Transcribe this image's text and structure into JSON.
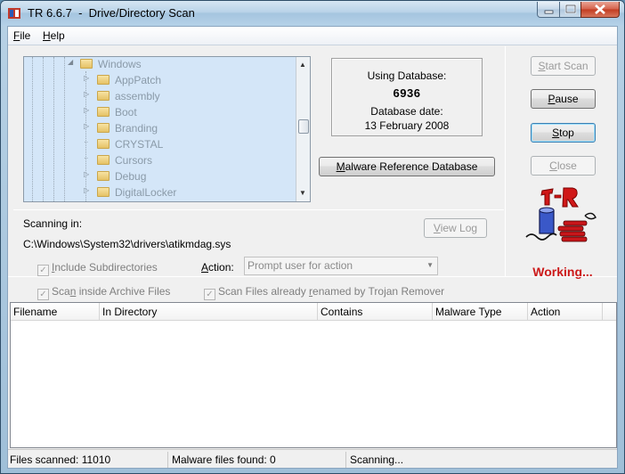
{
  "window": {
    "title": "TR 6.6.7  -  Drive/Directory Scan"
  },
  "menu": {
    "file_prefix": "",
    "file_hotkey": "F",
    "file_rest": "ile",
    "help_hotkey": "H",
    "help_rest": "elp"
  },
  "tree": {
    "root": "Windows",
    "items": [
      {
        "label": "AppPatch",
        "expandable": true
      },
      {
        "label": "assembly",
        "expandable": true
      },
      {
        "label": "Boot",
        "expandable": true
      },
      {
        "label": "Branding",
        "expandable": true
      },
      {
        "label": "CRYSTAL",
        "expandable": false
      },
      {
        "label": "Cursors",
        "expandable": false
      },
      {
        "label": "Debug",
        "expandable": true
      },
      {
        "label": "DigitalLocker",
        "expandable": true
      }
    ]
  },
  "database": {
    "using_label": "Using Database:",
    "number": "6936",
    "date_label": "Database date:",
    "date": "13 February 2008"
  },
  "buttons": {
    "malware_ref_hotkey": "M",
    "malware_ref_rest": "alware Reference Database",
    "start_scan_hotkey": "S",
    "start_scan_rest": "tart Scan",
    "pause_hotkey": "P",
    "pause_rest": "ause",
    "stop_hotkey": "S",
    "stop_rest": "top",
    "close_hotkey": "C",
    "close_rest": "lose",
    "view_log_hotkey": "V",
    "view_log_rest": "iew Log"
  },
  "scan": {
    "scanning_label": "Scanning in:",
    "path": "C:\\Windows\\System32\\drivers\\atikmdag.sys",
    "status_text": "Working..."
  },
  "options": {
    "subdirs_hotkey": "I",
    "subdirs_rest": "nclude Subdirectories",
    "subdirs_checked": true,
    "archive_pre": "Sca",
    "archive_hotkey": "n",
    "archive_rest": " inside Archive Files",
    "archive_checked": true,
    "renamed_pre": "Scan Files already ",
    "renamed_hotkey": "r",
    "renamed_rest": "enamed by Trojan Remover",
    "renamed_checked": true,
    "action_hotkey": "A",
    "action_rest": "ction:",
    "action_value": "Prompt user for action"
  },
  "results": {
    "columns": [
      "Filename",
      "In Directory",
      "Contains",
      "Malware Type",
      "Action"
    ]
  },
  "status": {
    "files_scanned": "Files scanned: 11010",
    "malware_found": "Malware files found: 0",
    "state": "Scanning..."
  },
  "colors": {
    "working_red": "#cc1a1a",
    "tree_bg": "#d4e6f8"
  }
}
